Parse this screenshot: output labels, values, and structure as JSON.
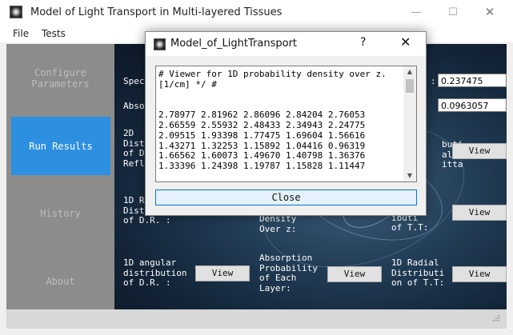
{
  "window": {
    "title": "Model of Light Transport in Multi-layered Tissues",
    "minimize_glyph": "—",
    "maximize_glyph": "☐",
    "close_glyph": "✕"
  },
  "menu": [
    "File",
    "Tests"
  ],
  "sidebar": {
    "items": [
      {
        "label": "Configure\nParameters"
      },
      {
        "label": "Run Results"
      },
      {
        "label": "History"
      },
      {
        "label": "About"
      }
    ],
    "active": "Run Results"
  },
  "content": {
    "specular_label": "Spec",
    "specular_value": "0.237475",
    "absorption_label": "Abso",
    "absorption_value": "0.0963057",
    "rows": [
      {
        "left": "2D\nDist\nof D\nRefl",
        "right": "buti\nal\nitta",
        "button": "View"
      },
      {
        "left": "1D R\nDist\nof D.R. :",
        "mid": "Density\nOver z:",
        "right": "ular\nibuti\nof T.T:",
        "button": "View"
      },
      {
        "left": "1D angular\ndistribution\nof D.R. :",
        "button_left": "View",
        "mid": "Absorption\nProbability\nof Each\nLayer:",
        "button_mid": "View",
        "right": "1D Radial\nDistributi\non of T.T:",
        "button": "View"
      }
    ]
  },
  "dialog": {
    "title": "Model_of_LightTransport",
    "help_glyph": "?",
    "close_glyph": "✕",
    "viewer_lines": [
      "# Viewer for 1D probability density over z.",
      "[1/cm] */ #",
      "",
      "",
      "2.78977 2.81962 2.86096 2.84204 2.76053",
      "2.66559 2.55932 2.48433 2.34943 2.24775",
      "2.09515 1.93398 1.77475 1.69604 1.56616",
      "1.43271 1.32253 1.15892 1.04416 0.96319",
      "1.66562 1.60073 1.49670 1.40798 1.36376",
      "1.33396 1.24398 1.19787 1.15828 1.11447"
    ],
    "scroll_up": "▲",
    "scroll_down": "▼",
    "close_label": "Close"
  }
}
